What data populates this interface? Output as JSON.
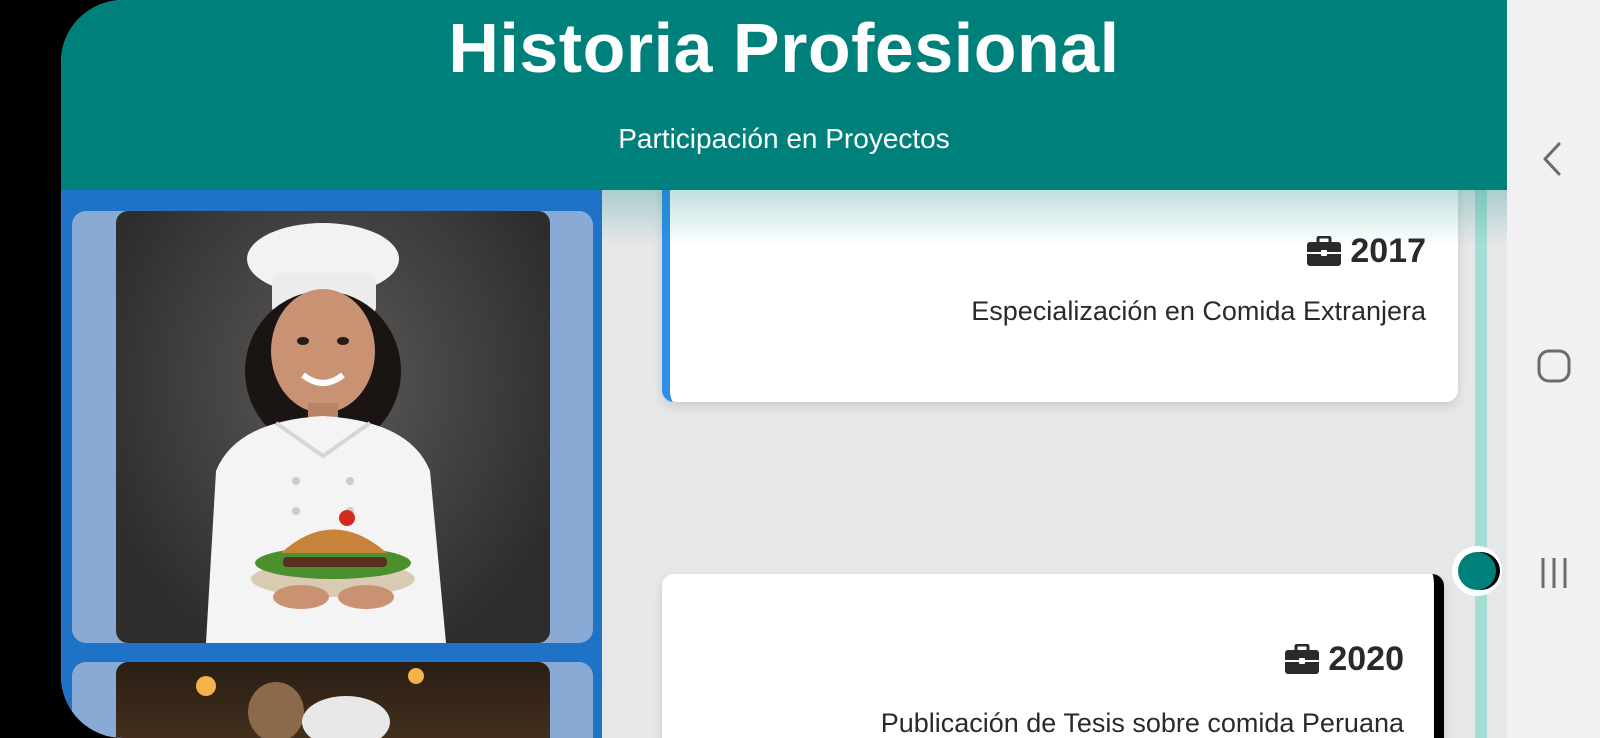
{
  "header": {
    "title": "Historia Profesional",
    "subtitle": "Participación en Proyectos"
  },
  "gallery": {
    "photos": [
      {
        "icon": "chef-photo",
        "alt": ""
      },
      {
        "icon": "chef-photo",
        "alt": ""
      }
    ]
  },
  "timeline": {
    "items": [
      {
        "year": "2017",
        "description": "Especialización en Comida Extranjera",
        "icon": "briefcase-icon",
        "accent": "#2f8ee8"
      },
      {
        "year": "2020",
        "description": "Publicación de Tesis sobre comida Peruana",
        "icon": "briefcase-icon",
        "accent": "#000000"
      }
    ]
  },
  "colors": {
    "header": "#00807b",
    "gallery_bg": "#1f73c7",
    "timeline_line": "#a6ddd4",
    "background": "#e6e7e9"
  },
  "navigation": {
    "buttons": [
      "back-icon",
      "home-icon",
      "recents-icon"
    ]
  }
}
